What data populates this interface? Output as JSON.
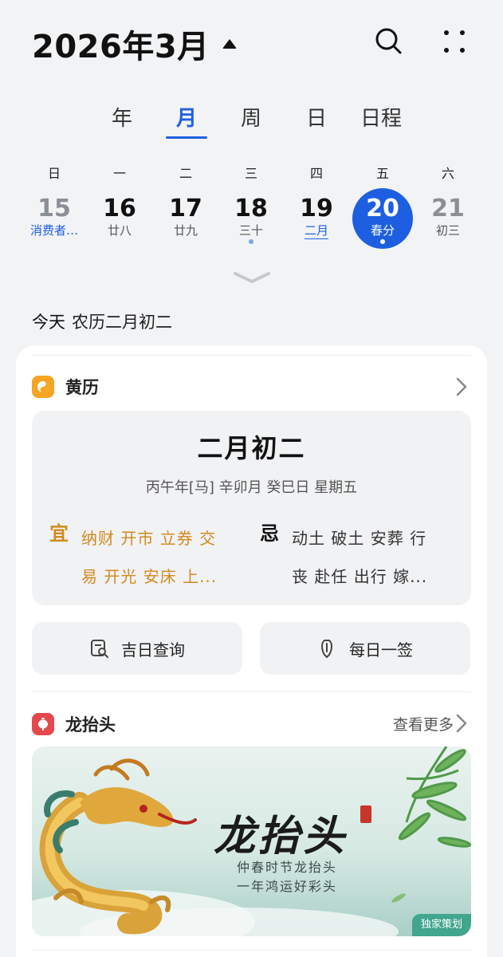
{
  "header": {
    "title": "2026年3月",
    "search_icon": "search-icon",
    "more_icon": "more-dots-icon"
  },
  "tabs": [
    {
      "label": "年",
      "active": false
    },
    {
      "label": "月",
      "active": true
    },
    {
      "label": "周",
      "active": false
    },
    {
      "label": "日",
      "active": false
    },
    {
      "label": "日程",
      "active": false
    }
  ],
  "weekdays": [
    "日",
    "一",
    "二",
    "三",
    "四",
    "五",
    "六"
  ],
  "days": [
    {
      "num": "15",
      "sub": "消费者…"
    },
    {
      "num": "16",
      "sub": "廿八"
    },
    {
      "num": "17",
      "sub": "廿九"
    },
    {
      "num": "18",
      "sub": "三十"
    },
    {
      "num": "19",
      "sub": "二月"
    },
    {
      "num": "20",
      "sub": "春分"
    },
    {
      "num": "21",
      "sub": "初三"
    }
  ],
  "today": {
    "label": "今天",
    "lunar": "农历二月初二"
  },
  "almanac": {
    "section_title": "黄历",
    "lunar_date": "二月初二",
    "ganzhi": "丙午年[马]  辛卯月 癸巳日 星期五",
    "yi_label": "宜",
    "yi_line1": "纳财 开市 立券 交",
    "yi_line2": "易 开光 安床 上...",
    "ji_label": "忌",
    "ji_line1": "动土 破土 安葬 行",
    "ji_line2": "丧 赴任 出行 嫁..."
  },
  "actions": {
    "lucky_day": "吉日查询",
    "daily_draw": "每日一签"
  },
  "festival": {
    "section_title": "龙抬头",
    "more": "查看更多",
    "banner_title": "龙抬头",
    "banner_line1": "仲春时节龙抬头",
    "banner_line2": "一年鸿运好彩头",
    "banner_tag": "独家策划"
  },
  "colors": {
    "accent": "#1d5fe0",
    "yi": "#d28a1e",
    "background": "#f1f3f5"
  }
}
